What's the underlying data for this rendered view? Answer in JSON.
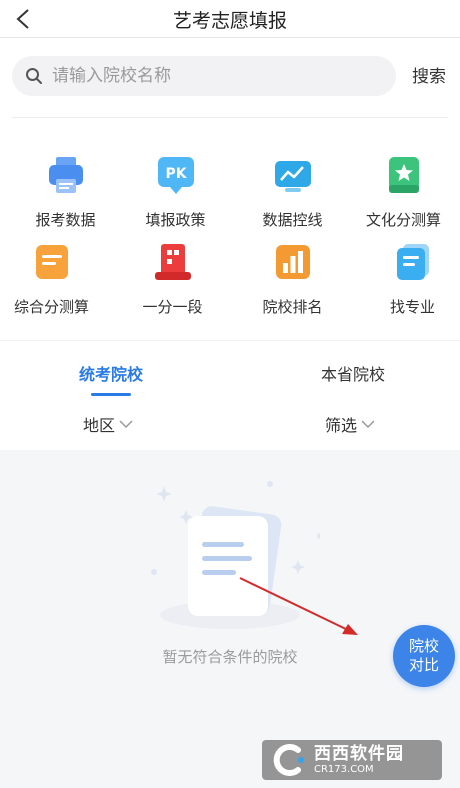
{
  "header": {
    "title": "艺考志愿填报"
  },
  "search": {
    "placeholder": "请输入院校名称",
    "button_label": "搜索"
  },
  "grid": {
    "items": [
      {
        "label": "报考数据",
        "icon": "printer-icon",
        "color": "#4a8ff0"
      },
      {
        "label": "填报政策",
        "icon": "pk-icon",
        "color": "#4fb7f5"
      },
      {
        "label": "数据控线",
        "icon": "monitor-chart-icon",
        "color": "#2fa8e8"
      },
      {
        "label": "文化分测算",
        "icon": "book-star-icon",
        "color": "#3cc47c"
      },
      {
        "label": "综合分测算",
        "icon": "document-icon",
        "color": "#f7a23a"
      },
      {
        "label": "一分一段",
        "icon": "building-icon",
        "color": "#ec3d3d"
      },
      {
        "label": "院校排名",
        "icon": "bar-chart-icon",
        "color": "#f39a32"
      },
      {
        "label": "找专业",
        "icon": "layers-icon",
        "color": "#3aaef0"
      }
    ]
  },
  "tabs": [
    {
      "label": "统考院校",
      "active": true
    },
    {
      "label": "本省院校",
      "active": false
    }
  ],
  "filters": [
    {
      "label": "地区"
    },
    {
      "label": "筛选"
    }
  ],
  "empty": {
    "text": "暂无符合条件的院校"
  },
  "compare_button": {
    "line1": "院校",
    "line2": "对比"
  },
  "watermark": {
    "title": "西西软件园",
    "subtitle": "CR173.COM"
  },
  "colors": {
    "accent": "#2a7be6",
    "compare_button": "#3d84e8",
    "annotation_arrow": "#d32a2a"
  }
}
